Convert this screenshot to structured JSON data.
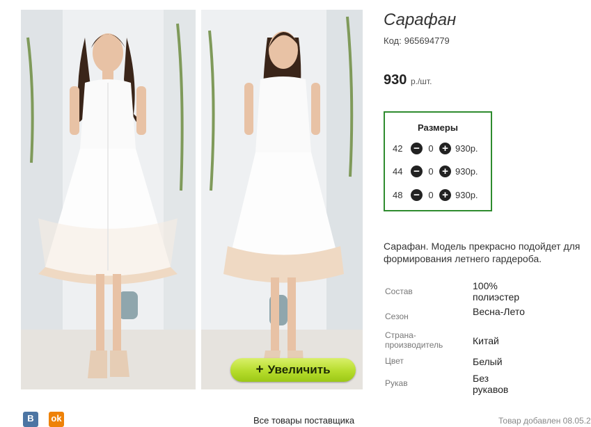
{
  "product": {
    "title": "Сарафан",
    "code_label": "Код:",
    "code": "965694779",
    "price": "930",
    "price_unit": "р./шт."
  },
  "zoom": {
    "icon": "+",
    "label": "Увеличить"
  },
  "sizes": {
    "heading": "Размеры",
    "rows": [
      {
        "size": "42",
        "qty": "0",
        "price": "930р."
      },
      {
        "size": "44",
        "qty": "0",
        "price": "930р."
      },
      {
        "size": "48",
        "qty": "0",
        "price": "930р."
      }
    ]
  },
  "description": "Сарафан. Модель прекрасно подойдет для формирования летнего гардероба.",
  "specs": [
    {
      "label": "Состав",
      "value": "100% полиэстер"
    },
    {
      "label": "Сезон",
      "value": "Весна-Лето"
    },
    {
      "label": "Страна-производитель",
      "value": "Китай"
    },
    {
      "label": "Цвет",
      "value": "Белый"
    },
    {
      "label": "Рукав",
      "value": "Без рукавов"
    }
  ],
  "footer": {
    "vk": "В",
    "ok": "ok",
    "all_goods": "Все товары поставщика",
    "added": "Товар добавлен 08.05.2"
  },
  "colors": {
    "size_border": "#2e8b2e",
    "zoom_button": "#b6dc2c"
  }
}
